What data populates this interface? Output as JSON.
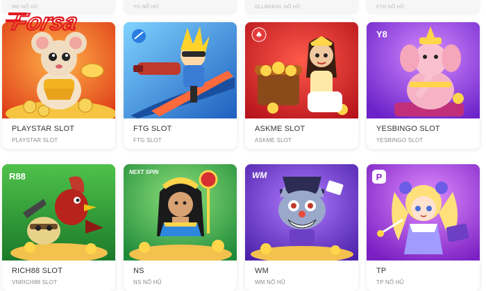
{
  "brand": {
    "logo_text": "Forsa",
    "accent": "#e21a22"
  },
  "top_row": [
    {
      "label": "MG NỔ HŨ"
    },
    {
      "label": "YG NỔ HŨ"
    },
    {
      "label": "GLLBRASIL NỔ HŨ"
    },
    {
      "label": "FTG NỔ HŨ"
    }
  ],
  "games": [
    {
      "title": "PLAYSTAR SLOT",
      "provider": "PLAYSTAR SLOT",
      "icon": "mouse-gold-icon"
    },
    {
      "title": "FTG SLOT",
      "provider": "FTG SLOT",
      "icon": "surfer-hero-icon"
    },
    {
      "title": "ASKME SLOT",
      "provider": "ASKME SLOT",
      "icon": "treasure-girl-icon",
      "badge": "♠"
    },
    {
      "title": "YESBINGO SLOT",
      "provider": "YESBINGO SLOT",
      "icon": "ganesha-icon",
      "badge": "Y8"
    },
    {
      "title": "RICH88 SLOT",
      "provider": "VNRICH88 SLOT",
      "icon": "rooster-icon",
      "badge": "R88"
    },
    {
      "title": "NS",
      "provider": "NS NỔ HŨ",
      "icon": "cleopatra-icon",
      "badge": "NEXT SPIN"
    },
    {
      "title": "WM",
      "provider": "WM NỔ HŨ",
      "icon": "clown-cat-icon",
      "badge": "WM"
    },
    {
      "title": "TP",
      "provider": "TP NỔ HŨ",
      "icon": "fairy-girl-icon",
      "badge": "P"
    }
  ]
}
